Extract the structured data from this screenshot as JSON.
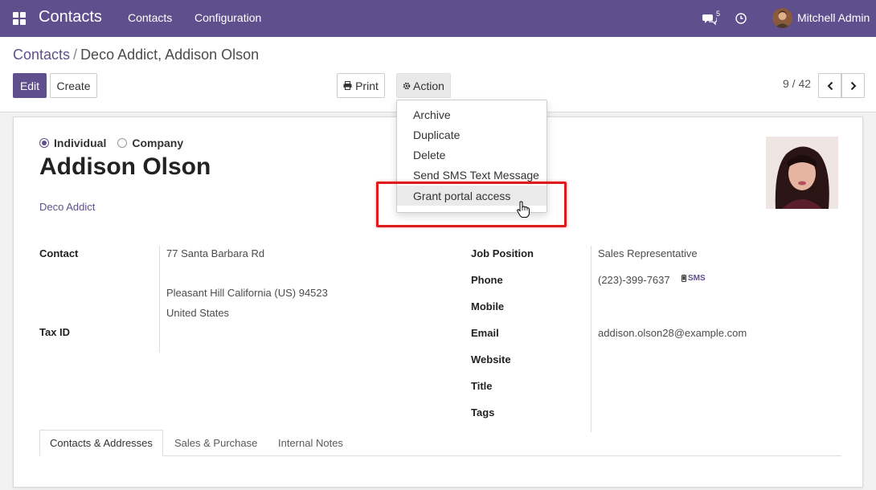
{
  "navbar": {
    "app_title": "Contacts",
    "menu": [
      "Contacts",
      "Configuration"
    ],
    "chat_badge": "5",
    "user_name": "Mitchell Admin"
  },
  "breadcrumb": {
    "parent": "Contacts",
    "separator": "/",
    "current": "Deco Addict, Addison Olson"
  },
  "buttons": {
    "edit": "Edit",
    "create": "Create",
    "print": "Print",
    "action": "Action"
  },
  "pager": {
    "value": "9 / 42"
  },
  "action_menu": {
    "items": [
      "Archive",
      "Duplicate",
      "Delete",
      "Send SMS Text Message",
      "Grant portal access"
    ]
  },
  "form": {
    "company_type": {
      "options": [
        "Individual",
        "Company"
      ],
      "selected": "Individual"
    },
    "name": "Addison Olson",
    "company": "Deco Addict",
    "left": {
      "contact_label": "Contact",
      "address_line1": "77 Santa Barbara Rd",
      "address_line2": "Pleasant Hill  California (US)  94523",
      "address_line3": "United States",
      "tax_id_label": "Tax ID"
    },
    "right": {
      "job_position_label": "Job Position",
      "job_position": "Sales Representative",
      "phone_label": "Phone",
      "phone": "(223)-399-7637",
      "sms_label": "SMS",
      "mobile_label": "Mobile",
      "email_label": "Email",
      "email": "addison.olson28@example.com",
      "website_label": "Website",
      "title_label": "Title",
      "tags_label": "Tags"
    },
    "tabs": [
      "Contacts & Addresses",
      "Sales & Purchase",
      "Internal Notes"
    ],
    "active_tab": "Contacts & Addresses"
  },
  "colors": {
    "brand": "#5f4f8d",
    "highlight": "#e01b1b"
  }
}
